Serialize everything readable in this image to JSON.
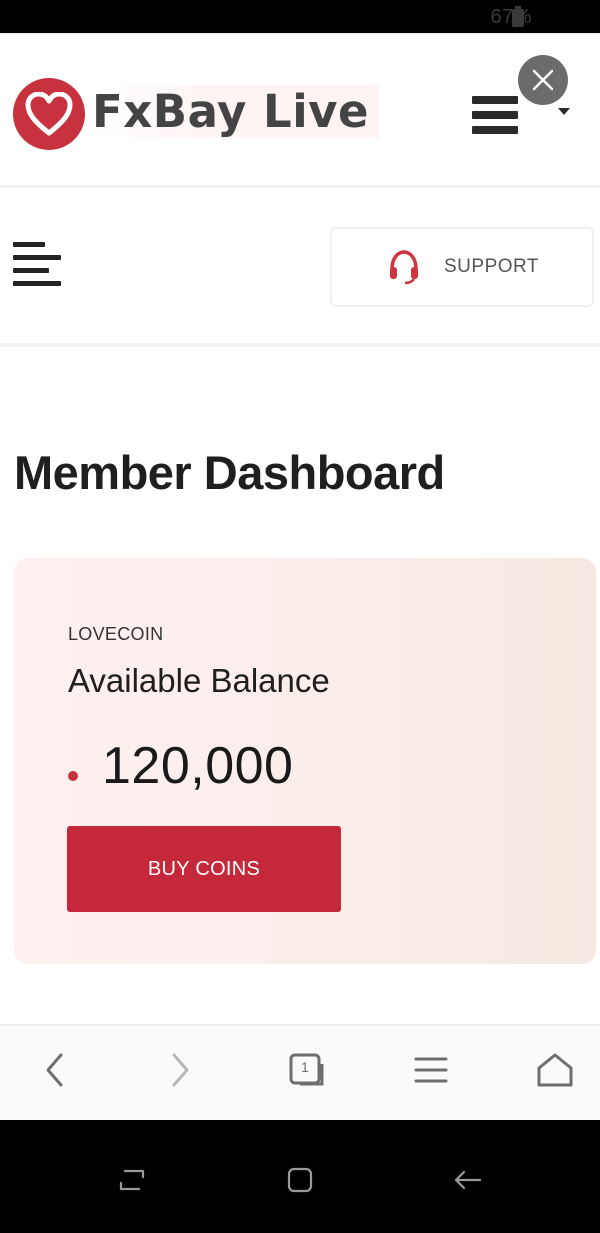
{
  "status_bar": {
    "battery_text": "67%",
    "battery_icon": "battery-icon"
  },
  "header": {
    "brand_name": "FxBay Live",
    "logo_icon": "heart-icon",
    "menu_icon": "hamburger-icon",
    "dropdown_icon": "caret-down-icon",
    "close_icon": "close-icon",
    "brand_color": "#c8323f"
  },
  "sub_nav": {
    "menu_icon": "menu-lines-icon",
    "support_label": "SUPPORT",
    "support_icon": "headset-icon"
  },
  "main": {
    "page_title": "Member Dashboard",
    "balance_card": {
      "currency_label": "LOVECOIN",
      "heading": "Available Balance",
      "balance": "120,000",
      "buy_button_label": "BUY COINS",
      "button_color": "#c4283a"
    }
  },
  "browser_bar": {
    "buttons": [
      "back-icon",
      "forward-icon",
      "tabs-icon",
      "menu-icon",
      "home-icon"
    ],
    "tab_count": "1"
  },
  "system_nav": {
    "buttons": [
      "recent-apps-icon",
      "home-square-icon",
      "back-arrow-icon"
    ]
  }
}
